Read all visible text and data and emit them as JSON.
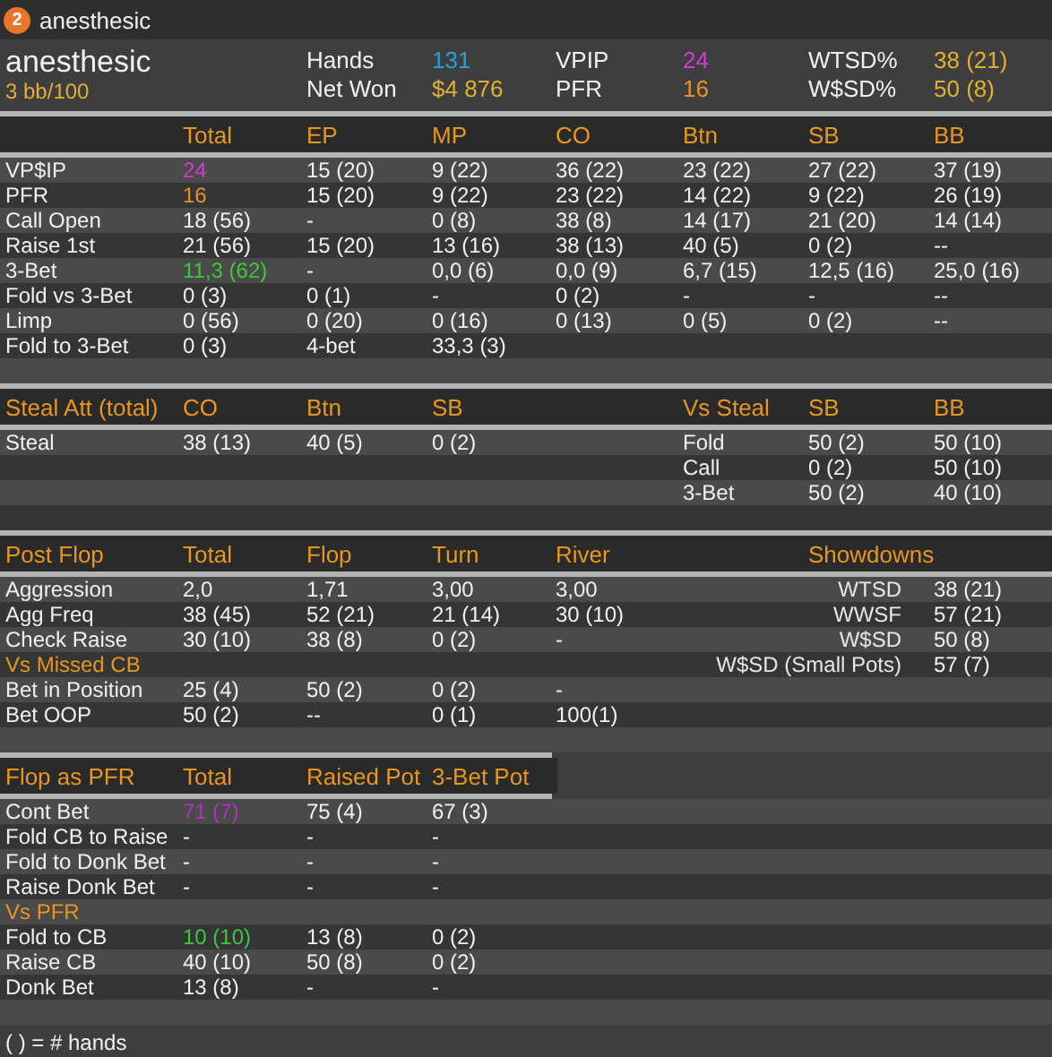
{
  "window": {
    "badge": "2",
    "title": "anesthesic"
  },
  "player": {
    "name": "anesthesic",
    "winrate": "3 bb/100",
    "stats": [
      {
        "label": "Hands",
        "value": "131",
        "color": "#2a9fd6"
      },
      {
        "label": "Net Won",
        "value": "$4 876",
        "color": "#e0b030"
      },
      {
        "label": "VPIP",
        "value": "24",
        "color": "#d23ad2"
      },
      {
        "label": "PFR",
        "value": "16",
        "color": "#e8902c"
      },
      {
        "label": "WTSD%",
        "value": "38 (21)",
        "color": "#e0b030"
      },
      {
        "label": "W$SD%",
        "value": "50 (8)",
        "color": "#e0b030"
      }
    ]
  },
  "preflop": {
    "columns": [
      "Total",
      "EP",
      "MP",
      "CO",
      "Btn",
      "SB",
      "BB"
    ],
    "rows": [
      {
        "label": "VP$IP",
        "cells": [
          {
            "text": "24",
            "color": "#d23ad2"
          },
          "15 (20)",
          "9 (22)",
          "36 (22)",
          "23 (22)",
          "27 (22)",
          "37 (19)"
        ]
      },
      {
        "label": "PFR",
        "cells": [
          {
            "text": "16",
            "color": "#e8902c"
          },
          "15 (20)",
          "9 (22)",
          "23 (22)",
          "14 (22)",
          "9 (22)",
          "26 (19)"
        ]
      },
      {
        "label": "Call Open",
        "cells": [
          "18 (56)",
          "-",
          "0 (8)",
          "38 (8)",
          "14 (17)",
          "21 (20)",
          "14 (14)"
        ]
      },
      {
        "label": "Raise 1st",
        "cells": [
          "21 (56)",
          "15 (20)",
          "13 (16)",
          "38 (13)",
          "40 (5)",
          "0 (2)",
          "--"
        ]
      },
      {
        "label": "3-Bet",
        "cells": [
          {
            "text": "11,3 (62)",
            "color": "#3cc83c"
          },
          "-",
          "0,0 (6)",
          "0,0 (9)",
          "6,7 (15)",
          "12,5 (16)",
          "25,0 (16)"
        ]
      },
      {
        "label": "Fold vs 3-Bet",
        "cells": [
          "0 (3)",
          "0 (1)",
          "-",
          "0 (2)",
          "-",
          "-",
          "--"
        ]
      },
      {
        "label": "Limp",
        "cells": [
          "0 (56)",
          "0 (20)",
          "0 (16)",
          "0 (13)",
          "0 (5)",
          "0 (2)",
          "--"
        ]
      },
      {
        "label": "Fold to 3-Bet",
        "cells": [
          "0 (3)",
          "4-bet",
          "33,3 (3)"
        ]
      }
    ]
  },
  "steal": {
    "title": "Steal Att (total)",
    "columns": [
      "CO",
      "Btn",
      "SB"
    ],
    "rows": [
      {
        "label": "Steal",
        "cells": [
          "38 (13)",
          "40 (5)",
          "0 (2)"
        ]
      }
    ],
    "vs_steal": {
      "title": "Vs Steal",
      "columns": [
        "SB",
        "BB"
      ],
      "rows": [
        {
          "label": "Fold",
          "cells": [
            "50 (2)",
            "50 (10)"
          ]
        },
        {
          "label": "Call",
          "cells": [
            "0 (2)",
            "50 (10)"
          ]
        },
        {
          "label": "3-Bet",
          "cells": [
            "50 (2)",
            "40 (10)"
          ]
        }
      ]
    }
  },
  "postflop": {
    "title": "Post Flop",
    "columns": [
      "Total",
      "Flop",
      "Turn",
      "River"
    ],
    "rows": [
      {
        "kind": "stat",
        "label": "Aggression",
        "cells": [
          "2,0",
          "1,71",
          "3,00",
          "3,00"
        ]
      },
      {
        "kind": "stat",
        "label": "Agg Freq",
        "cells": [
          "38 (45)",
          "52 (21)",
          "21 (14)",
          "30 (10)"
        ]
      },
      {
        "kind": "stat",
        "label": "Check Raise",
        "cells": [
          "30 (10)",
          "38 (8)",
          "0 (2)",
          "-"
        ]
      },
      {
        "kind": "subheader",
        "label": "Vs Missed CB"
      },
      {
        "kind": "stat",
        "label": "Bet in Position",
        "cells": [
          "25 (4)",
          "50 (2)",
          "0 (2)",
          "-"
        ]
      },
      {
        "kind": "stat",
        "label": "Bet OOP",
        "cells": [
          "50 (2)",
          "--",
          "0 (1)",
          "100(1)"
        ]
      }
    ],
    "showdowns": {
      "title": "Showdowns",
      "rows": [
        {
          "label": "WTSD",
          "value": "38 (21)"
        },
        {
          "label": "WWSF",
          "value": "57 (21)"
        },
        {
          "label": "W$SD",
          "value": "50 (8)"
        },
        {
          "label": "W$SD (Small Pots)",
          "value": "57 (7)"
        }
      ]
    }
  },
  "flop_as_pfr": {
    "title": "Flop as PFR",
    "columns": [
      "Total",
      "Raised Pot",
      "3-Bet Pot"
    ],
    "rows": [
      {
        "kind": "stat",
        "label": "Cont Bet",
        "cells": [
          {
            "text": "71 (7)",
            "color": "#b030c0"
          },
          "75 (4)",
          "67 (3)"
        ]
      },
      {
        "kind": "stat",
        "label": "Fold CB to Raise",
        "cells": [
          "-",
          "-",
          "-"
        ]
      },
      {
        "kind": "stat",
        "label": "Fold to Donk Bet",
        "cells": [
          "-",
          "-",
          "-"
        ]
      },
      {
        "kind": "stat",
        "label": "Raise Donk Bet",
        "cells": [
          "-",
          "-",
          "-"
        ]
      },
      {
        "kind": "subheader",
        "label": "Vs PFR"
      },
      {
        "kind": "stat",
        "label": "Fold to CB",
        "cells": [
          {
            "text": "10 (10)",
            "color": "#3cc83c"
          },
          "13 (8)",
          "0 (2)"
        ]
      },
      {
        "kind": "stat",
        "label": "Raise CB",
        "cells": [
          "40 (10)",
          "50 (8)",
          "0 (2)"
        ]
      },
      {
        "kind": "stat",
        "label": "Donk Bet",
        "cells": [
          "13 (8)",
          "-",
          "-"
        ]
      }
    ]
  },
  "footer": "( ) = # hands"
}
